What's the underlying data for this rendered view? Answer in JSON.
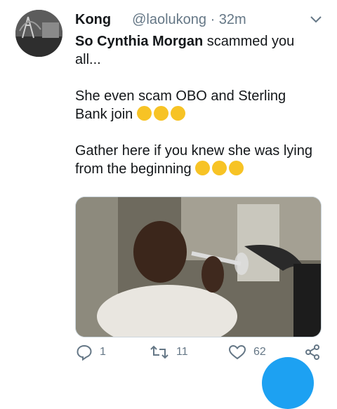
{
  "tweet": {
    "author_name": "Kong",
    "handle_time": "@laolukong · 32m",
    "line1_bold": "So Cynthia Morgan",
    "line1_rest": " scammed you all...",
    "para2": "She even scam OBO and Sterling Bank join",
    "para2_emojis": [
      "rofl-emoji",
      "rofl-emoji",
      "rofl-emoji"
    ],
    "para3": "Gather here if you knew she was lying from the beginning",
    "para3_emojis": [
      "joy-emoji",
      "joy-emoji",
      "joy-emoji"
    ]
  },
  "actions": {
    "reply_count": "1",
    "retweet_count": "11",
    "like_count": "62"
  },
  "colors": {
    "muted": "#657786",
    "accent": "#1da1f2",
    "emoji_face": "#f7c325"
  }
}
